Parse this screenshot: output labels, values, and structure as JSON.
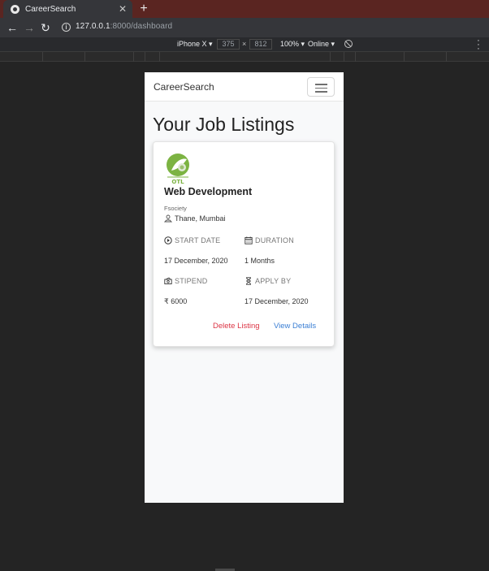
{
  "browser": {
    "tab_title": "CareerSearch",
    "url_host": "127.0.0.1",
    "url_path": ":8000/dashboard",
    "close_glyph": "✕",
    "new_tab_glyph": "+",
    "back_glyph": "←",
    "forward_glyph": "→",
    "reload_glyph": "↻"
  },
  "device_toolbar": {
    "device": "iPhone X ▾",
    "width": "375",
    "times": "×",
    "height": "812",
    "zoom": "100% ▾",
    "network": "Online ▾"
  },
  "app": {
    "brand": "CareerSearch",
    "page_title": "Your Job Listings",
    "listing": {
      "title": "Web Development",
      "company": "Fsociety",
      "location": "Thane, Mumbai",
      "start_date_label": "START DATE",
      "start_date": "17 December, 2020",
      "duration_label": "DURATION",
      "duration": "1 Months",
      "stipend_label": "STIPEND",
      "stipend": "₹ 6000",
      "apply_by_label": "APPLY BY",
      "apply_by": "17 December, 2020",
      "delete_label": "Delete Listing",
      "details_label": "View Details"
    }
  },
  "colors": {
    "delete": "#dc3545",
    "details": "#3b7fd4",
    "logo_green": "#7cb342"
  }
}
